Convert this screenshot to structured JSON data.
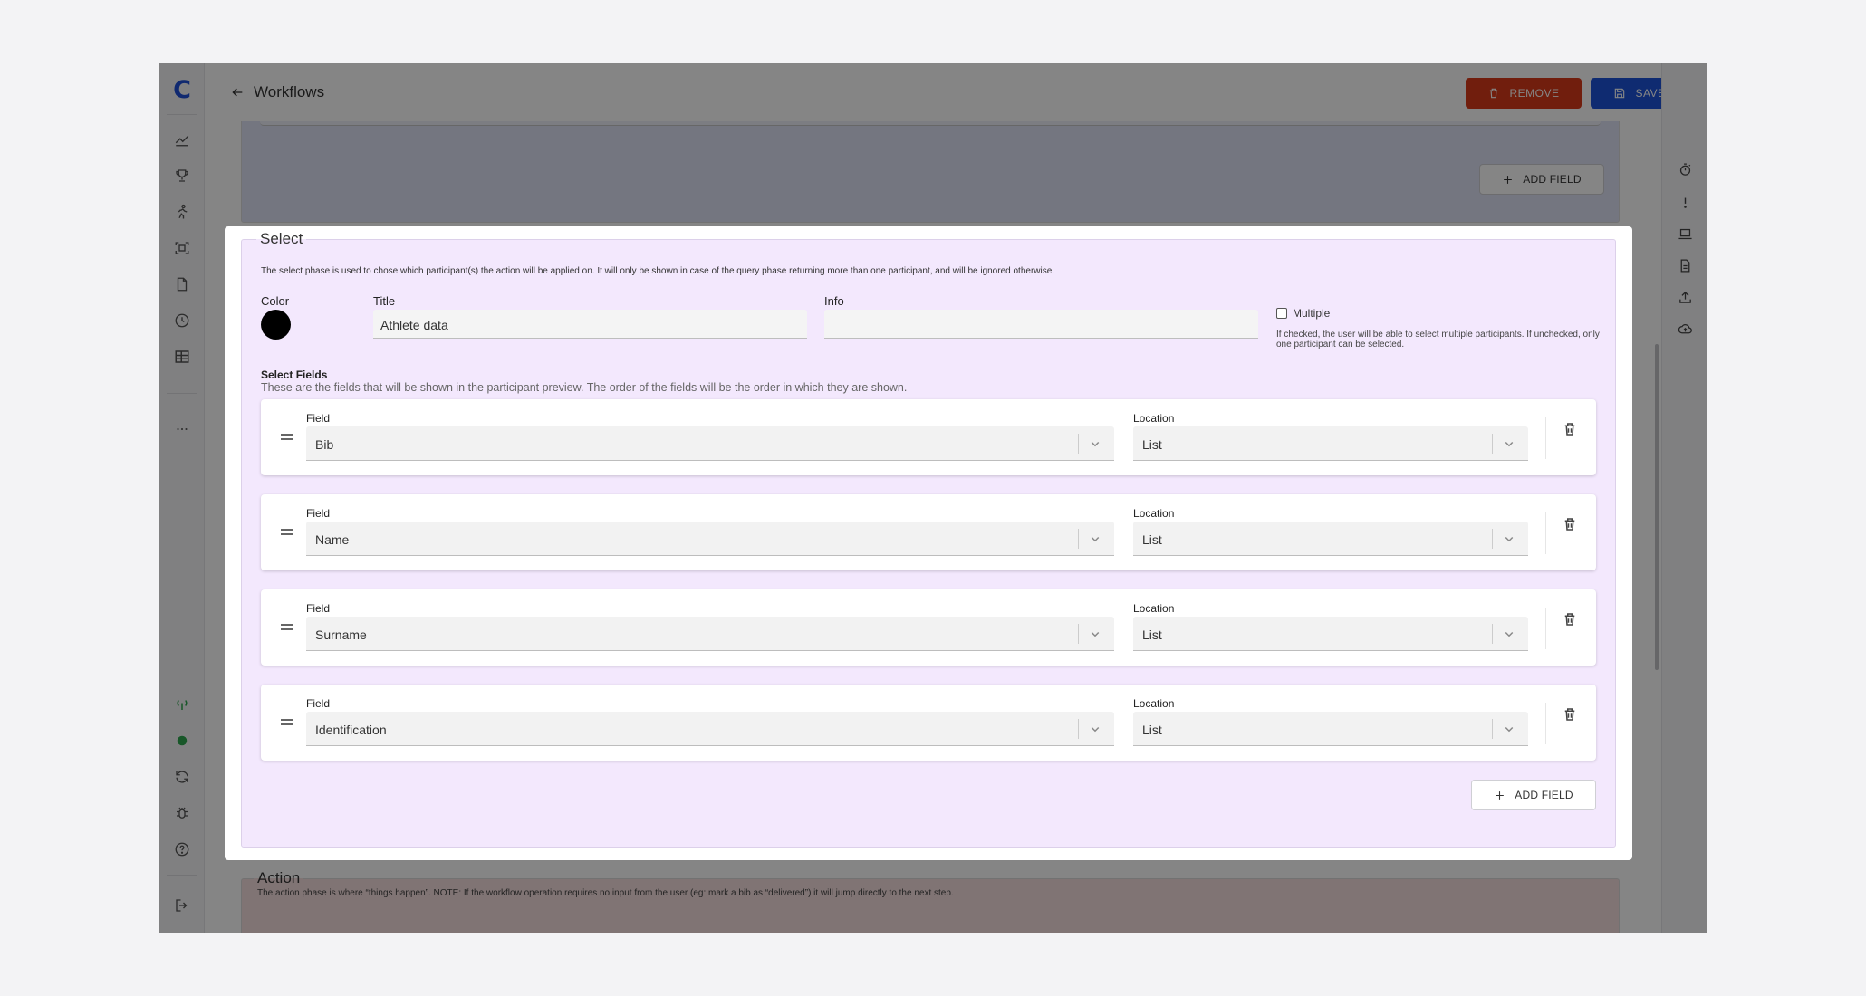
{
  "app": {
    "logo": "C"
  },
  "header": {
    "back_label": "Workflows",
    "remove_label": "REMOVE",
    "save_label": "SAVE"
  },
  "left_nav": {
    "items": [
      "chart-line-icon",
      "trophy-icon",
      "runner-icon",
      "scan-icon",
      "document-icon",
      "clock-icon",
      "table-icon",
      "more-icon"
    ],
    "bottom": [
      "signal-icon",
      "status-dot-icon",
      "sync-icon",
      "bug-icon",
      "help-icon",
      "logout-icon"
    ]
  },
  "right_rail": {
    "items": [
      "stopwatch-icon",
      "alert-icon",
      "laptop-icon",
      "file-icon",
      "upload-icon",
      "cloud-upload-icon"
    ]
  },
  "previous_section": {
    "add_field_label": "ADD FIELD"
  },
  "select_section": {
    "legend": "Select",
    "description": "The select phase is used to chose which participant(s) the action will be applied on. It will only be shown in case of the query phase returning more than one participant, and will be ignored otherwise.",
    "color_label": "Color",
    "color_value": "#000000",
    "title_label": "Title",
    "title_value": "Athlete data",
    "info_label": "Info",
    "info_value": "",
    "multiple_label": "Multiple",
    "multiple_checked": false,
    "multiple_help": "If checked, the user will be able to select multiple participants. If unchecked, only one participant can be selected.",
    "fields_title": "Select Fields",
    "fields_description": "These are the fields that will be shown in the participant preview. The order of the fields will be the order in which they are shown.",
    "field_label": "Field",
    "location_label": "Location",
    "rows": [
      {
        "field": "Bib",
        "location": "List"
      },
      {
        "field": "Name",
        "location": "List"
      },
      {
        "field": "Surname",
        "location": "List"
      },
      {
        "field": "Identification",
        "location": "List"
      }
    ],
    "add_field_label": "ADD FIELD"
  },
  "action_section": {
    "legend": "Action",
    "description": "The action phase is where “things happen”. NOTE: If the workflow operation requires no input from the user (eg: mark a bib as “delivered”) it will jump directly to the next step."
  },
  "colors": {
    "remove": "#d93a1a",
    "save": "#1e54d8",
    "select_bg": "#f3e8fd",
    "logo": "#1f4fd6",
    "status": "#2fa84f"
  }
}
